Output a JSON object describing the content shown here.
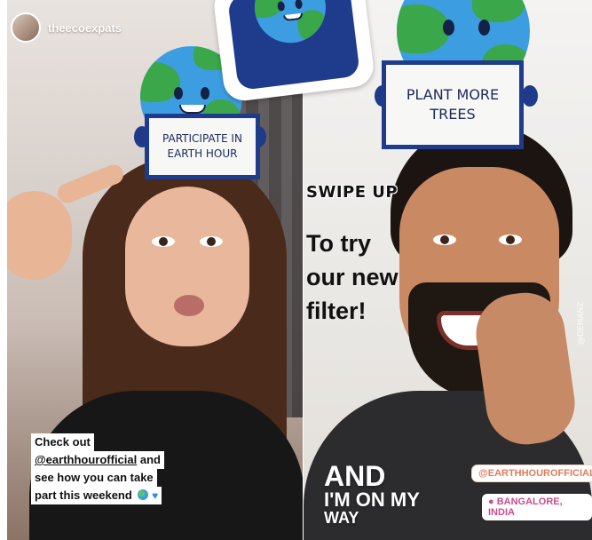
{
  "profile": {
    "username": "theecoexpats"
  },
  "left_story": {
    "sign_text": "PARTICIPATE IN EARTH HOUR",
    "caption": {
      "line1": "Check out",
      "mention": "@earthhourofficial",
      "line2_suffix": " and",
      "line3": "see how you can take",
      "line4": "part this weekend",
      "emojis": [
        "globe-emoji",
        "blue-heart-emoji"
      ]
    }
  },
  "right_story": {
    "sign_text": "PLANT MORE TREES",
    "swipe_up": "SWIPE UP",
    "cta_lines": [
      "To try",
      "our new",
      "filter!"
    ],
    "and_text": {
      "line1": "AND",
      "line2": "I'M ON MY",
      "line3": "WAY"
    },
    "mention_sticker": "@EARTHHOUROFFICIAL",
    "location_sticker": "BANGALORE, INDIA",
    "watermark": "@DEMANZ"
  },
  "icons": [
    "earth-mascot-icon",
    "location-pin-icon"
  ],
  "colors": {
    "sign_border": "#1f3b8c",
    "globe_ocean": "#3c9ee0",
    "globe_land": "#3aa74a",
    "mention_sticker": "#e17b5a",
    "location_sticker": "#c94d8c"
  }
}
